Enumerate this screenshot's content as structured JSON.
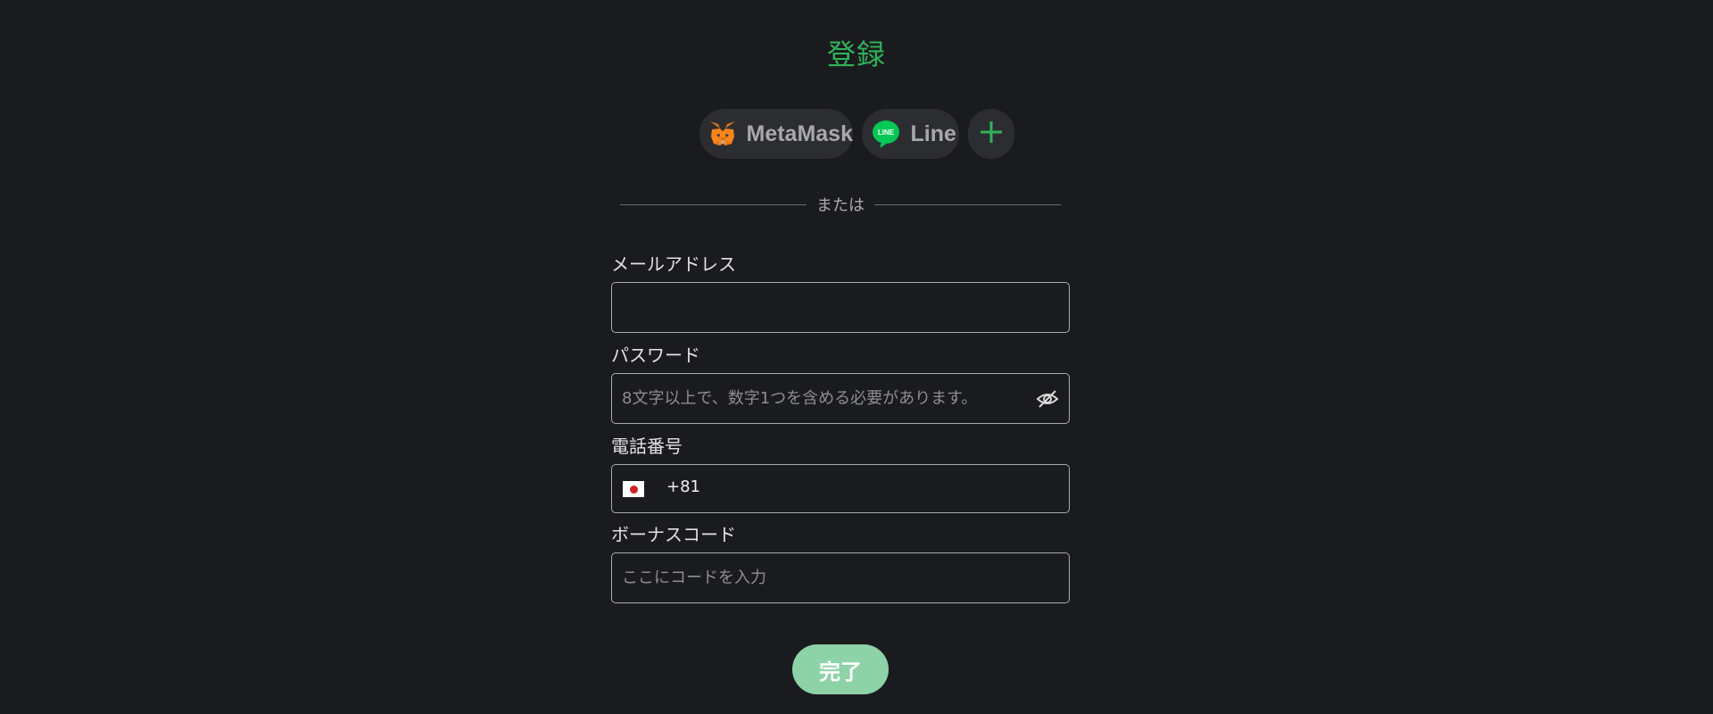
{
  "title": "登録",
  "social": {
    "metamask_label": "MetaMask",
    "metamask_icon": "metamask-fox-icon",
    "line_label": "Line",
    "line_icon": "line-logo-icon",
    "line_badge": "LINE",
    "more_icon": "plus-icon"
  },
  "divider_text": "または",
  "form": {
    "email": {
      "label": "メールアドレス",
      "value": "",
      "placeholder": ""
    },
    "password": {
      "label": "パスワード",
      "value": "",
      "placeholder": "8文字以上で、数字1つを含める必要があります。",
      "toggle_icon": "eye-slash-icon"
    },
    "phone": {
      "label": "電話番号",
      "country_icon": "japan-flag-icon",
      "dial_code": "+81",
      "value": ""
    },
    "bonus_code": {
      "label": "ボーナスコード",
      "value": "",
      "placeholder": "ここにコードを入力"
    }
  },
  "submit_label": "完了",
  "colors": {
    "background": "#1a1b1f",
    "accent": "#2fb35a",
    "submit_bg": "#8ed2a8",
    "line_green": "#06c755",
    "pill_bg": "#2c2d31"
  }
}
